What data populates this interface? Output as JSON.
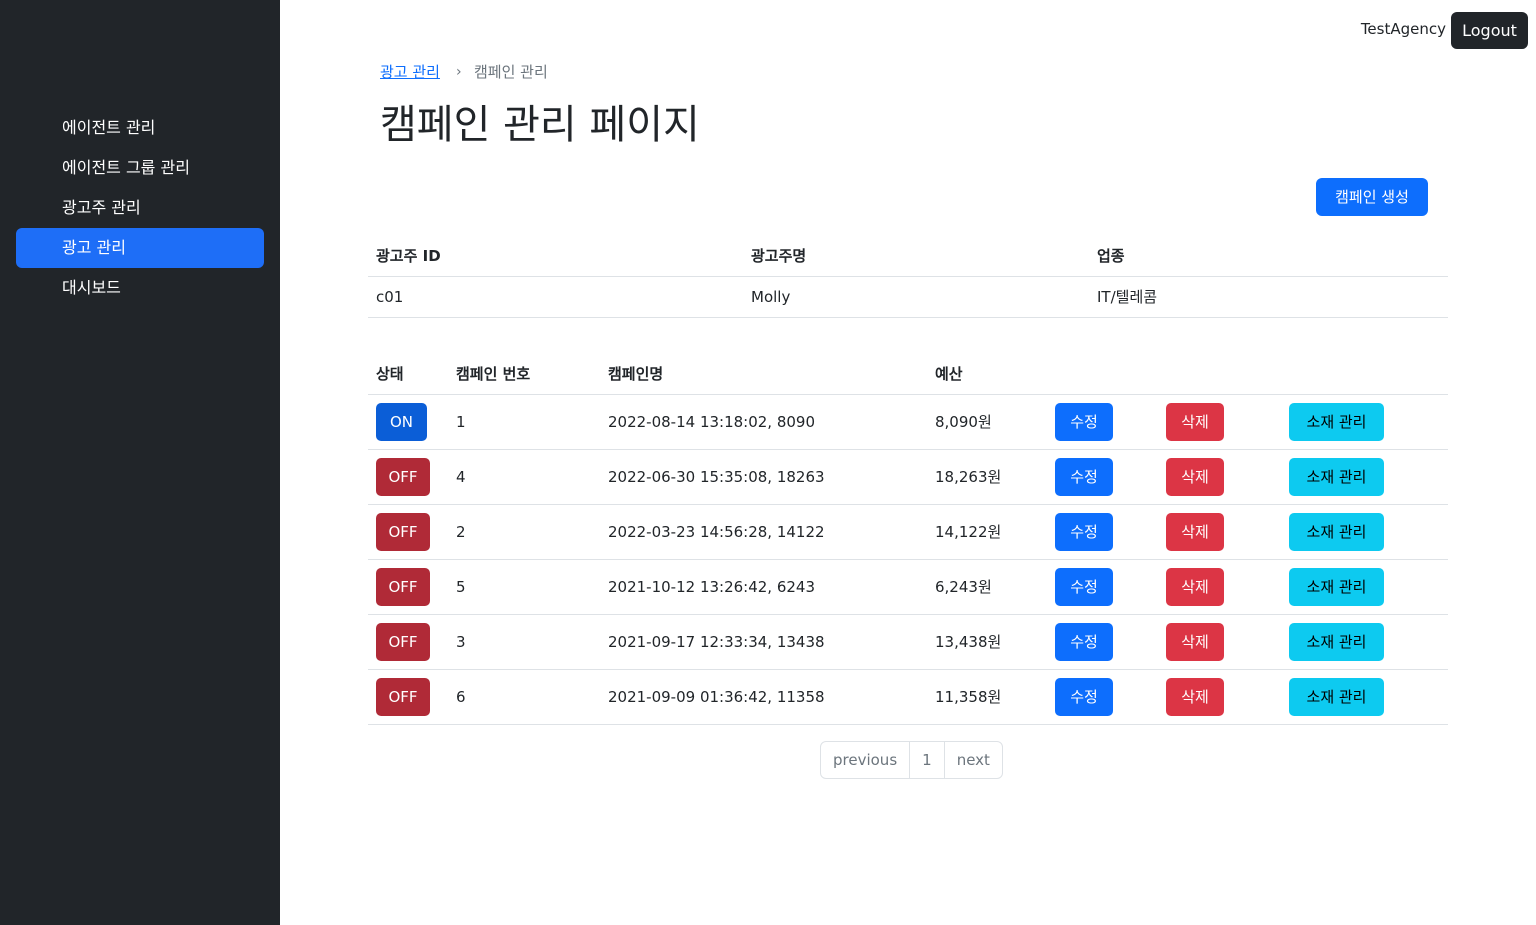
{
  "sidebar": {
    "items": [
      {
        "label": "에이전트 관리",
        "active": false
      },
      {
        "label": "에이전트 그룹 관리",
        "active": false
      },
      {
        "label": "광고주 관리",
        "active": false
      },
      {
        "label": "광고 관리",
        "active": true
      },
      {
        "label": "대시보드",
        "active": false
      }
    ]
  },
  "header": {
    "user": "TestAgency",
    "logout_label": "Logout"
  },
  "breadcrumb": {
    "parent": "광고 관리",
    "separator": "›",
    "current": "캠페인 관리"
  },
  "page_title": "캠페인 관리 페이지",
  "create_button": "캠페인 생성",
  "advertiser_table": {
    "headers": [
      "광고주 ID",
      "광고주명",
      "업종"
    ],
    "row": [
      "c01",
      "Molly",
      "IT/텔레콤"
    ]
  },
  "campaign_table": {
    "headers": [
      "상태",
      "캠페인 번호",
      "캠페인명",
      "예산"
    ],
    "actions": {
      "edit": "수정",
      "delete": "삭제",
      "materials": "소재 관리"
    },
    "rows": [
      {
        "status": "ON",
        "number": "1",
        "name": "2022-08-14 13:18:02, 8090",
        "budget": "8,090원"
      },
      {
        "status": "OFF",
        "number": "4",
        "name": "2022-06-30 15:35:08, 18263",
        "budget": "18,263원"
      },
      {
        "status": "OFF",
        "number": "2",
        "name": "2022-03-23 14:56:28, 14122",
        "budget": "14,122원"
      },
      {
        "status": "OFF",
        "number": "5",
        "name": "2021-10-12 13:26:42, 6243",
        "budget": "6,243원"
      },
      {
        "status": "OFF",
        "number": "3",
        "name": "2021-09-17 12:33:34, 13438",
        "budget": "13,438원"
      },
      {
        "status": "OFF",
        "number": "6",
        "name": "2021-09-09 01:36:42, 11358",
        "budget": "11,358원"
      }
    ]
  },
  "pagination": {
    "previous": "previous",
    "pages": [
      "1"
    ],
    "next": "next"
  },
  "colors": {
    "sidebar_bg": "#212529",
    "active_item": "#1e6ef7",
    "primary": "#0d6efd",
    "danger": "#dc3545",
    "info": "#0dcaf0",
    "status_on": "#0b5ed7",
    "status_off": "#b02a37"
  }
}
